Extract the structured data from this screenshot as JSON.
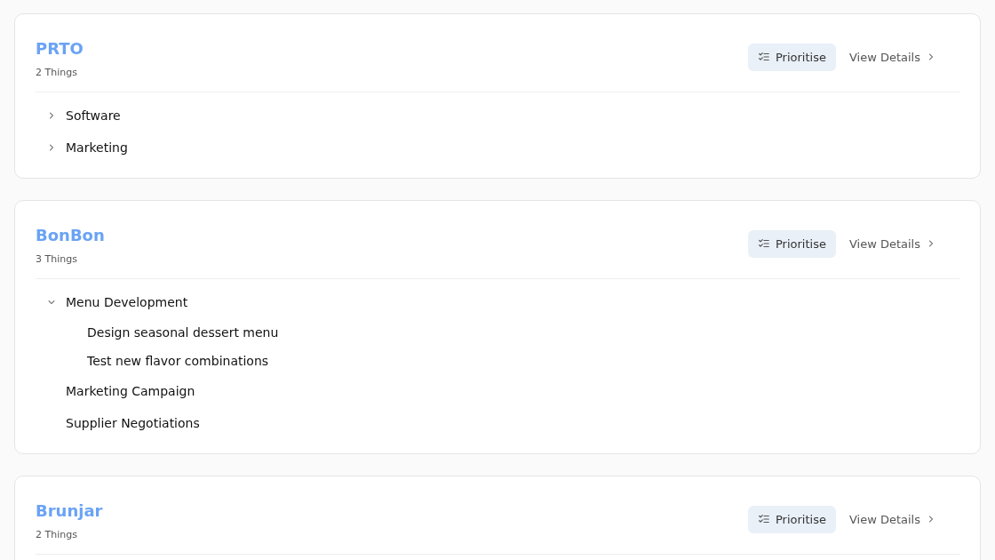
{
  "projects": [
    {
      "title": "PRTO",
      "count": "2 Things",
      "prioritise": "Prioritise",
      "details": "View Details",
      "items": [
        {
          "kind": "group",
          "label": "Software",
          "expanded": false
        },
        {
          "kind": "group",
          "label": "Marketing",
          "expanded": false
        }
      ]
    },
    {
      "title": "BonBon",
      "count": "3 Things",
      "prioritise": "Prioritise",
      "details": "View Details",
      "items": [
        {
          "kind": "group",
          "label": "Menu Development",
          "expanded": true,
          "children": [
            {
              "kind": "item",
              "label": "Design seasonal dessert menu"
            },
            {
              "kind": "item",
              "label": "Test new flavor combinations"
            }
          ]
        },
        {
          "kind": "item",
          "label": "Marketing Campaign"
        },
        {
          "kind": "item",
          "label": "Supplier Negotiations"
        }
      ]
    },
    {
      "title": "Brunjar",
      "count": "2 Things",
      "prioritise": "Prioritise",
      "details": "View Details"
    }
  ]
}
